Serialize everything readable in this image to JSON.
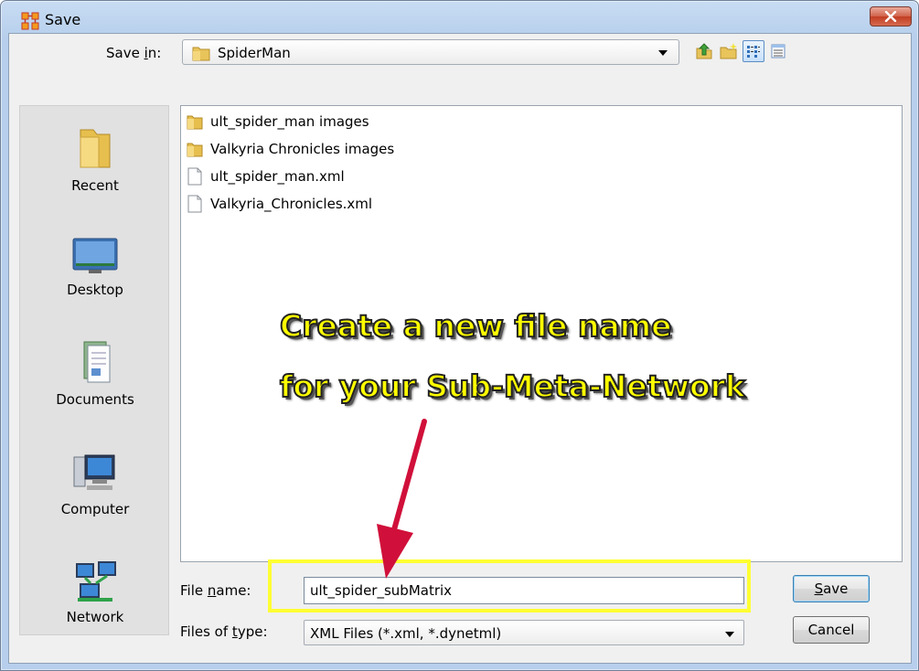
{
  "window": {
    "title": "Save"
  },
  "save_in": {
    "label_prefix": "Save ",
    "label_mnemonic": "i",
    "label_suffix": "n:",
    "value": "SpiderMan"
  },
  "toolbar": {
    "icons": [
      "up-one-level-icon",
      "create-new-folder-icon",
      "list-view-icon",
      "details-view-icon"
    ]
  },
  "places": [
    {
      "label": "Recent",
      "icon": "recent-folder-icon"
    },
    {
      "label": "Desktop",
      "icon": "desktop-icon"
    },
    {
      "label": "Documents",
      "icon": "documents-icon"
    },
    {
      "label": "Computer",
      "icon": "computer-icon"
    },
    {
      "label": "Network",
      "icon": "network-icon"
    }
  ],
  "files": [
    {
      "name": "ult_spider_man images",
      "type": "folder"
    },
    {
      "name": "Valkyria Chronicles images",
      "type": "folder"
    },
    {
      "name": "ult_spider_man.xml",
      "type": "file"
    },
    {
      "name": "Valkyria_Chronicles.xml",
      "type": "file"
    }
  ],
  "file_name": {
    "label_prefix": "File ",
    "label_mnemonic": "n",
    "label_suffix": "ame:",
    "value": "ult_spider_subMatrix"
  },
  "file_type": {
    "label_prefix": "Files of ",
    "label_mnemonic": "t",
    "label_suffix": "ype:",
    "value": "XML Files (*.xml, *.dynetml)"
  },
  "buttons": {
    "save_mnemonic": "S",
    "save_rest": "ave",
    "cancel": "Cancel"
  },
  "annotation": {
    "line1": "Create a new file name",
    "line2": "for your Sub-Meta-Network",
    "highlight_color": "#ffff33",
    "arrow_color": "#d0103a",
    "text_color": "#ffff00"
  }
}
